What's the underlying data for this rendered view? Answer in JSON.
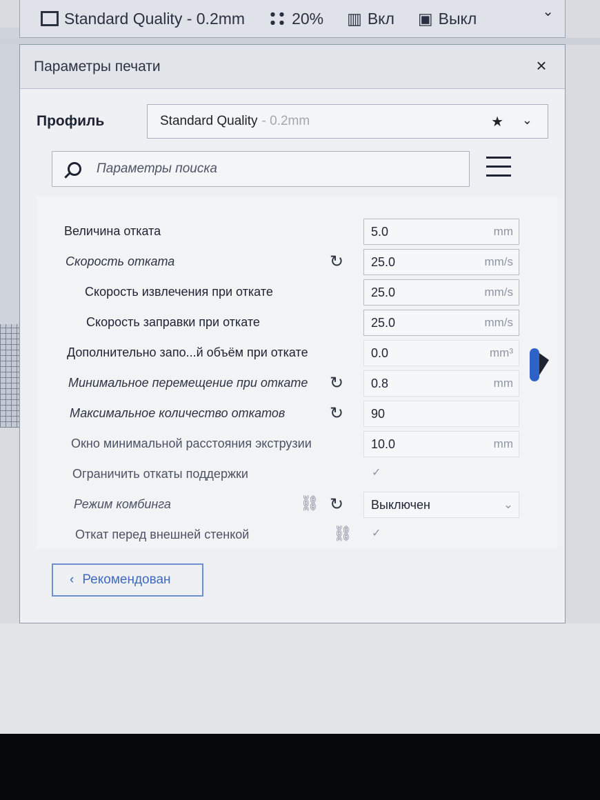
{
  "topbar": {
    "profile": "Standard Quality - 0.2mm",
    "infill": "20%",
    "support": "Вкл",
    "adhesion": "Выкл"
  },
  "dialog": {
    "title": "Параметры печати",
    "close": "×",
    "profile_label": "Профиль",
    "profile_name": "Standard Quality",
    "profile_layer": "- 0.2mm",
    "search_placeholder": "Параметры поиска",
    "recommended_button": "Рекомендован"
  },
  "settings": [
    {
      "label": "Величина отката",
      "value": "5.0",
      "unit": "mm"
    },
    {
      "label": "Скорость отката",
      "value": "25.0",
      "unit": "mm/s"
    },
    {
      "label": "Скорость извлечения при откате",
      "value": "25.0",
      "unit": "mm/s"
    },
    {
      "label": "Скорость заправки при откате",
      "value": "25.0",
      "unit": "mm/s"
    },
    {
      "label": "Дополнительно запо...й объём при откате",
      "value": "0.0",
      "unit": "mm³"
    },
    {
      "label": "Минимальное перемещение при откате",
      "value": "0.8",
      "unit": "mm"
    },
    {
      "label": "Максимальное количество откатов",
      "value": "90",
      "unit": ""
    },
    {
      "label": "Окно минимальной расстояния экструзии",
      "value": "10.0",
      "unit": "mm"
    },
    {
      "label": "Ограничить откаты поддержки",
      "value": "✓",
      "unit": ""
    },
    {
      "label": "Режим комбинга",
      "value": "Выключен",
      "unit": ""
    },
    {
      "label": "Откат перед внешней стенкой",
      "value": "✓",
      "unit": ""
    }
  ]
}
